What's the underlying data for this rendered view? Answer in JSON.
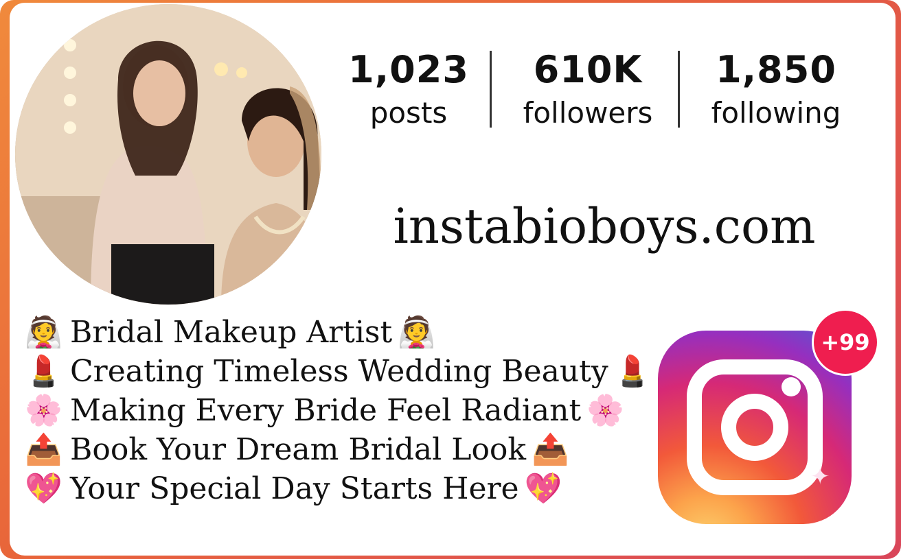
{
  "profile": {
    "avatar_icon": "profile-avatar-makeup-artist-photo"
  },
  "stats": {
    "posts": {
      "value": "1,023",
      "label": "posts"
    },
    "followers": {
      "value": "610K",
      "label": "followers"
    },
    "following": {
      "value": "1,850",
      "label": "following"
    }
  },
  "website": "instabioboys.com",
  "bio": [
    {
      "emoji": "👰",
      "text": "Bridal Makeup Artist",
      "emoji_end": "👰"
    },
    {
      "emoji": "💄",
      "text": "Creating Timeless Wedding Beauty",
      "emoji_end": "💄"
    },
    {
      "emoji": "🌸",
      "text": "Making Every Bride Feel Radiant",
      "emoji_end": "🌸"
    },
    {
      "emoji": "📤",
      "text": "Book Your Dream Bridal Look",
      "emoji_end": "📤"
    },
    {
      "emoji": "💖",
      "text": "Your Special Day Starts Here",
      "emoji_end": "💖"
    }
  ],
  "notification_badge": "+99",
  "colors": {
    "border_gradient": [
      "#f08a3c",
      "#d9465a"
    ],
    "badge": "#ef1e4f"
  },
  "icons": {
    "instagram": "instagram-logo-icon",
    "sparkle": "sparkle-icon"
  }
}
